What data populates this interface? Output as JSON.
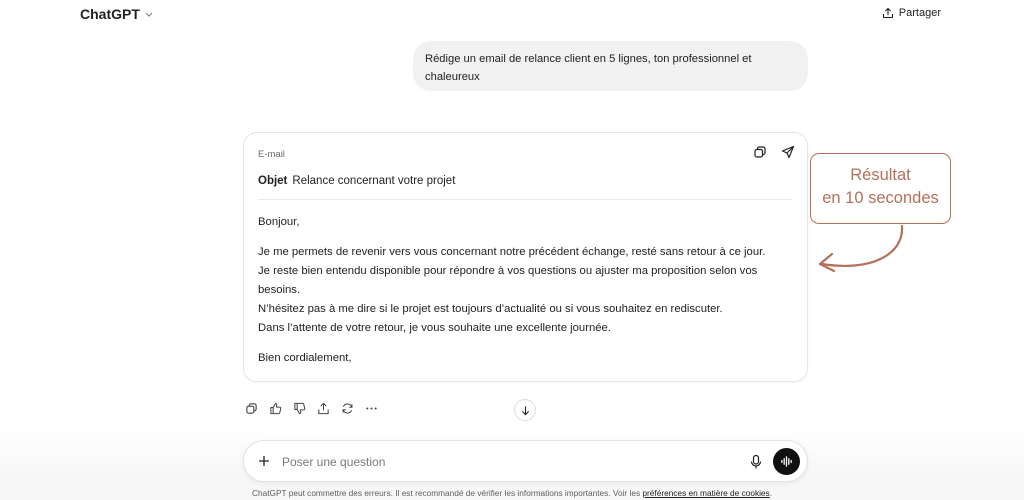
{
  "header": {
    "app_title": "ChatGPT",
    "share_label": "Partager"
  },
  "user_message": {
    "text": "Rédige un email de relance client en 5 lignes, ton professionnel et chaleureux"
  },
  "email": {
    "kind_label": "E-mail",
    "subject_label": "Objet",
    "subject_value": "Relance concernant votre projet",
    "greeting": "Bonjour,",
    "lines": [
      "Je me permets de revenir vers vous concernant notre précédent échange, resté sans retour à ce jour.",
      "Je reste bien entendu disponible pour répondre à vos questions ou ajuster ma proposition selon vos besoins.",
      "N’hésitez pas à me dire si le projet est toujours d’actualité ou si vous souhaitez en rediscuter.",
      "Dans l’attente de votre retour, je vous souhaite une excellente journée."
    ],
    "closing": "Bien cordialement,"
  },
  "composer": {
    "placeholder": "Poser une question"
  },
  "disclaimer": {
    "text": "ChatGPT peut commettre des erreurs. Il est recommandé de vérifier les informations importantes. Voir les ",
    "link": "préférences en matière de cookies",
    "end": "."
  },
  "annotation": {
    "line1": "Résultat",
    "line2": "en 10 secondes",
    "color": "#b4705a"
  },
  "icons": {
    "share": "share-icon",
    "copy": "copy-icon",
    "send": "send-icon",
    "thumbs_up": "thumbs-up-icon",
    "thumbs_down": "thumbs-down-icon",
    "regenerate": "regenerate-icon",
    "more": "more-icon",
    "scroll_down": "arrow-down-icon",
    "plus": "plus-icon",
    "mic": "mic-icon",
    "voice": "voice-mode-icon"
  }
}
